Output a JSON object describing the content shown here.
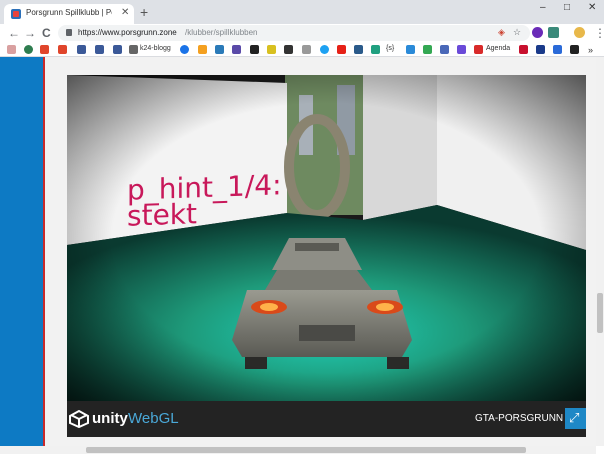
{
  "browser": {
    "tab_title": "Porsgrunn Spillklubb | Porsg",
    "new_tab": "+",
    "tab_close": "✕",
    "back": "←",
    "forward": "→",
    "reload": "C",
    "url_host": "https://www.porsgrunn.zone",
    "url_path": "/klubber/spillklubben",
    "star": "☆",
    "menu": "⋮",
    "minimize": "–",
    "maximize": "□",
    "close": "✕"
  },
  "bookmarks": {
    "k24": "k24-blogg",
    "agenda": "Agenda",
    "braces": "{s}"
  },
  "game": {
    "hint_text": "p_hint_1/4:\nstekt"
  },
  "unity": {
    "brand": "unity",
    "product": "WebGL",
    "title": "GTA-PORSGRUNN",
    "fullscreen_icon": "⤢"
  },
  "colors": {
    "accent_blue": "#0d7ac4",
    "accent_red": "#c92b2b",
    "hint_pink": "#c8185a",
    "webgl_blue": "#4aa8d8"
  }
}
